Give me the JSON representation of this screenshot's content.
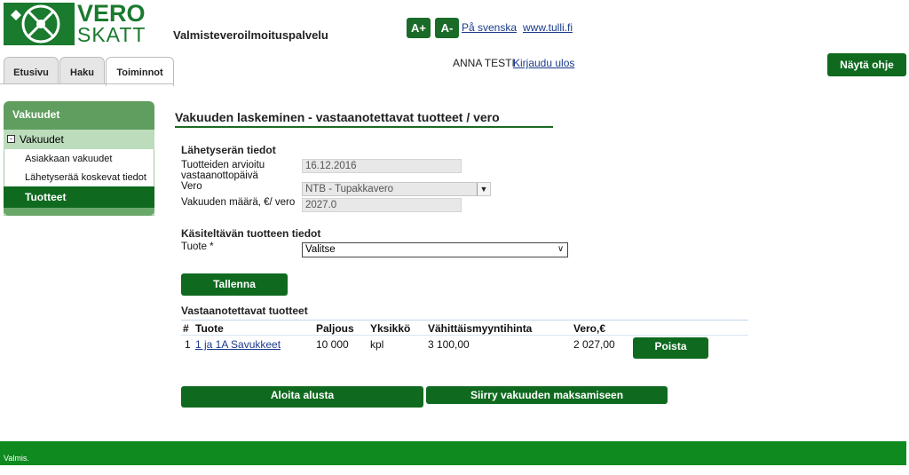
{
  "header": {
    "logo_top": "VERO",
    "logo_bottom": "SKATT",
    "service_title": "Valmisteveroilmoituspalvelu",
    "font_increase": "A+",
    "font_decrease": "A-",
    "swedish_link": "På svenska",
    "site_link": "www.tulli.fi",
    "user_name": "ANNA TESTI",
    "logout_link": "Kirjaudu ulos",
    "help_button": "Näytä ohje"
  },
  "tabs": [
    {
      "label": "Etusivu",
      "active": false
    },
    {
      "label": "Haku",
      "active": false
    },
    {
      "label": "Toiminnot",
      "active": true
    }
  ],
  "sidebar": {
    "title": "Vakuudet",
    "group": {
      "label": "Vakuudet",
      "toggle": "-"
    },
    "items": [
      {
        "label": "Asiakkaan vakuudet",
        "active": false
      },
      {
        "label": "Lähetyserää koskevat tiedot",
        "active": false
      },
      {
        "label": "Tuotteet",
        "active": true
      }
    ]
  },
  "main": {
    "title": "Vakuuden laskeminen - vastaanotettavat tuotteet / vero",
    "shipment": {
      "heading": "Lähetyserän tiedot",
      "date_label_1": "Tuotteiden arvioitu",
      "date_label_2": "vastaanottopäivä",
      "date_value": "16.12.2016",
      "tax_label": "Vero",
      "tax_value": "NTB - Tupakkavero",
      "amount_label": "Vakuuden määrä, €/ vero",
      "amount_value": "2027.0"
    },
    "product": {
      "heading": "Käsiteltävän tuotteen tiedot",
      "product_label": "Tuote *",
      "product_value": "Valitse"
    },
    "save_button": "Tallenna",
    "received": {
      "heading": "Vastaanotettavat tuotteet",
      "columns": [
        "#",
        "Tuote",
        "Paljous",
        "Yksikkö",
        "Vähittäismyyntihinta",
        "Vero,€"
      ],
      "rows": [
        {
          "num": "1",
          "product": "1 ja 1A Savukkeet",
          "quantity": "10 000",
          "unit": "kpl",
          "retail_price": "3 100,00",
          "tax": "2 027,00",
          "action": "Poista"
        }
      ]
    },
    "restart_button": "Aloita alusta",
    "payment_button": "Siirry vakuuden maksamiseen"
  },
  "status_bar": {
    "text": "Valmis."
  },
  "colors": {
    "brand_green": "#0f6a1f",
    "footer_green": "#0f8a1f",
    "sidebar_green": "#5f9e5f",
    "link_blue": "#1a3a8a"
  }
}
